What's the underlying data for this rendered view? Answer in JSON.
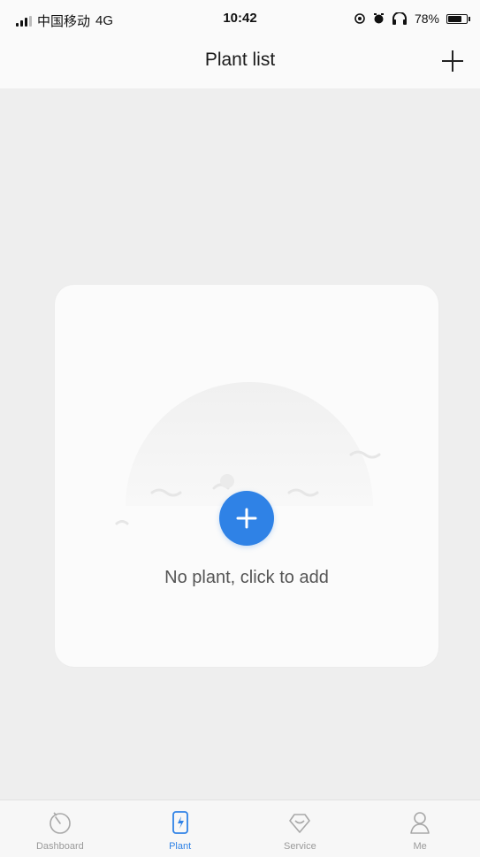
{
  "status_bar": {
    "carrier": "中国移动",
    "network": "4G",
    "time": "10:42",
    "battery": "78%",
    "battery_level": 0.78
  },
  "header": {
    "title": "Plant list",
    "add_icon": "plus-icon"
  },
  "empty_state": {
    "message": "No plant, click to add",
    "add_icon": "plus-icon"
  },
  "tab_bar": {
    "items": [
      {
        "label": "Dashboard",
        "icon": "dashboard-icon",
        "active": false
      },
      {
        "label": "Plant",
        "icon": "plant-icon",
        "active": true
      },
      {
        "label": "Service",
        "icon": "service-icon",
        "active": false
      },
      {
        "label": "Me",
        "icon": "user-icon",
        "active": false
      }
    ]
  },
  "colors": {
    "accent": "#2f82e6",
    "background": "#eeeeee",
    "card": "#fbfbfb",
    "tab_inactive": "#9a9a9a"
  }
}
